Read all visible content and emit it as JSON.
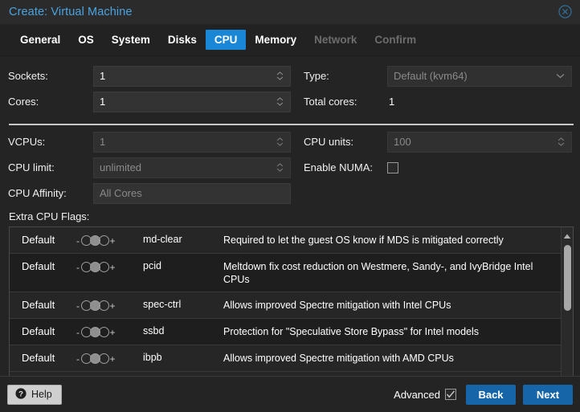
{
  "window": {
    "title": "Create: Virtual Machine",
    "close_icon": "close-circle-icon"
  },
  "tabs": [
    {
      "label": "General",
      "state": "normal"
    },
    {
      "label": "OS",
      "state": "normal"
    },
    {
      "label": "System",
      "state": "normal"
    },
    {
      "label": "Disks",
      "state": "normal"
    },
    {
      "label": "CPU",
      "state": "active"
    },
    {
      "label": "Memory",
      "state": "normal"
    },
    {
      "label": "Network",
      "state": "disabled"
    },
    {
      "label": "Confirm",
      "state": "disabled"
    }
  ],
  "form": {
    "sockets": {
      "label": "Sockets:",
      "value": "1"
    },
    "cores": {
      "label": "Cores:",
      "value": "1"
    },
    "type": {
      "label": "Type:",
      "value": "Default (kvm64)"
    },
    "total_cores": {
      "label": "Total cores:",
      "value": "1"
    },
    "vcpus": {
      "label": "VCPUs:",
      "value": "1"
    },
    "cpu_limit": {
      "label": "CPU limit:",
      "value": "unlimited"
    },
    "cpu_affinity": {
      "label": "CPU Affinity:",
      "value": "All Cores"
    },
    "cpu_units": {
      "label": "CPU units:",
      "value": "100"
    },
    "enable_numa": {
      "label": "Enable NUMA:",
      "checked": false
    }
  },
  "flags_section": {
    "label": "Extra CPU Flags:",
    "rows": [
      {
        "state_label": "Default",
        "selected": "default",
        "flag": "md-clear",
        "description": "Required to let the guest OS know if MDS is mitigated correctly"
      },
      {
        "state_label": "Default",
        "selected": "default",
        "flag": "pcid",
        "description": "Meltdown fix cost reduction on Westmere, Sandy-, and IvyBridge Intel CPUs"
      },
      {
        "state_label": "Default",
        "selected": "default",
        "flag": "spec-ctrl",
        "description": "Allows improved Spectre mitigation with Intel CPUs"
      },
      {
        "state_label": "Default",
        "selected": "default",
        "flag": "ssbd",
        "description": "Protection for \"Speculative Store Bypass\" for Intel models"
      },
      {
        "state_label": "Default",
        "selected": "default",
        "flag": "ibpb",
        "description": "Allows improved Spectre mitigation with AMD CPUs"
      }
    ],
    "minus_sign": "-",
    "plus_sign": "+"
  },
  "footer": {
    "help_label": "Help",
    "help_icon": "question-circle-icon",
    "advanced_label": "Advanced",
    "advanced_checked": true,
    "back_label": "Back",
    "next_label": "Next"
  },
  "colors": {
    "accent": "#1a86d6",
    "button": "#1565a8",
    "title": "#4aa3e0",
    "background": "#242424"
  }
}
